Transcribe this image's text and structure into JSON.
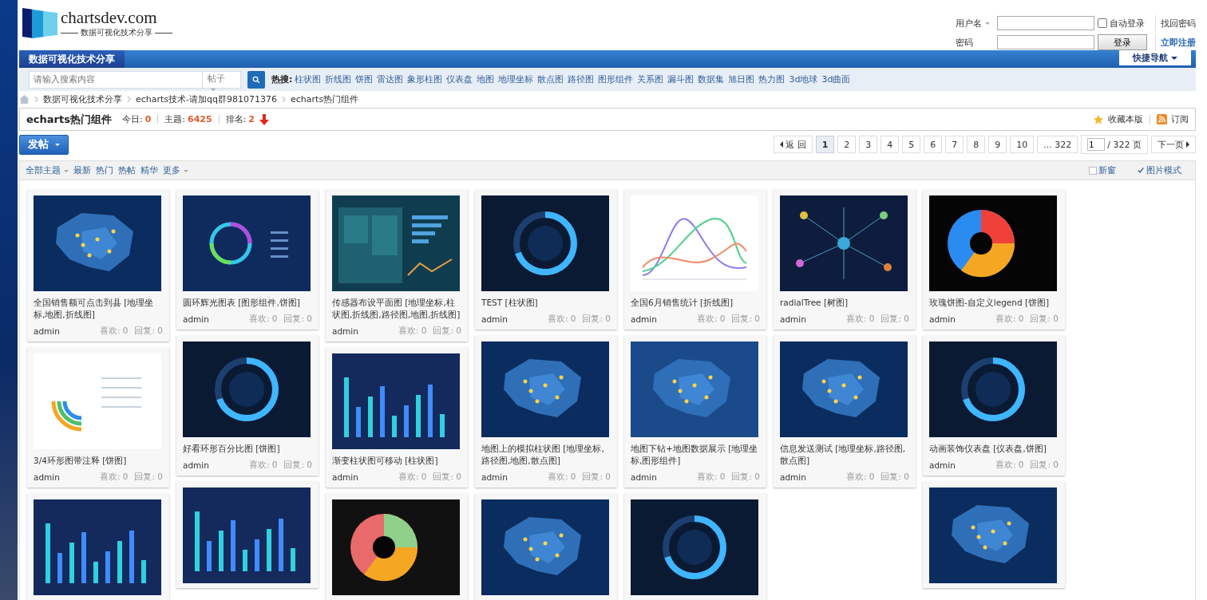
{
  "logo": {
    "name": "chartsdev.com",
    "tagline": "数据可视化技术分享"
  },
  "login": {
    "username_label": "用户名",
    "password_label": "密码",
    "remember": {
      "label": "自动登录",
      "checked": false
    },
    "forgot": "找回密码",
    "submit": "登录",
    "register": "立即注册"
  },
  "nav": {
    "home_tab": "数据可视化技术分享",
    "quick_nav": "快捷导航"
  },
  "search": {
    "placeholder": "请输入搜索内容",
    "scope": "帖子",
    "hot_label": "热搜:",
    "hot": [
      "柱状图",
      "折线图",
      "饼图",
      "雷达图",
      "象形柱图",
      "仪表盘",
      "地图",
      "地理坐标",
      "散点图",
      "路径图",
      "图形组件",
      "关系图",
      "漏斗图",
      "数据集",
      "旭日图",
      "热力图",
      "3d地球",
      "3d曲面"
    ]
  },
  "breadcrumb": [
    "数据可视化技术分享",
    "echarts技术-请加qq群981071376",
    "echarts热门组件"
  ],
  "forum": {
    "title": "echarts热门组件",
    "stats": [
      {
        "label": "今日:",
        "value": "0"
      },
      {
        "label": "主题:",
        "value": "6425"
      },
      {
        "label": "排名:",
        "value": "2"
      }
    ],
    "favorite": "收藏本版",
    "subscribe": "订阅"
  },
  "post_button": "发帖",
  "pagination": {
    "back": "返 回",
    "pages": [
      {
        "label": "1",
        "selected": true
      },
      {
        "label": "2",
        "selected": false
      },
      {
        "label": "3",
        "selected": false
      },
      {
        "label": "4",
        "selected": false
      },
      {
        "label": "5",
        "selected": false
      },
      {
        "label": "6",
        "selected": false
      },
      {
        "label": "7",
        "selected": false
      },
      {
        "label": "8",
        "selected": false
      },
      {
        "label": "9",
        "selected": false
      },
      {
        "label": "10",
        "selected": false
      }
    ],
    "last": "... 322",
    "page_input": "1",
    "total": "/ 322 页",
    "next": "下一页"
  },
  "filters": {
    "all": "全部主题",
    "links": [
      "最新",
      "热门",
      "热帖",
      "精华"
    ],
    "more": "更多",
    "options": [
      {
        "label": "新窗",
        "checked": false
      },
      {
        "label": "图片模式",
        "checked": true
      }
    ]
  },
  "columns": [
    [
      {
        "title": "全国销售额可点击到县 [地理坐标,地图,折线图]",
        "author": "admin",
        "likes": "喜欢: 0",
        "replies": "回复: 0"
      },
      {
        "title": "3/4环形图带注释 [饼图]",
        "author": "admin",
        "likes": "喜欢: 0",
        "replies": "回复: 0"
      },
      {
        "kind": "picture"
      }
    ],
    [
      {
        "title": "圆环辉光图表 [图形组件,饼图]",
        "author": "admin",
        "likes": "喜欢: 0",
        "replies": "回复: 0"
      },
      {
        "title": "好看环形百分比图 [饼图]",
        "author": "admin",
        "likes": "喜欢: 0",
        "replies": "回复: 0"
      },
      {
        "kind": "picture"
      }
    ],
    [
      {
        "title": "传感器布设平面图 [地理坐标,柱状图,折线图,路径图,地图,折线图]",
        "author": "admin",
        "likes": "喜欢: 0",
        "replies": "回复: 0"
      },
      {
        "title": "渐变柱状图可移动 [柱状图]",
        "author": "admin",
        "likes": "喜欢: 0",
        "replies": "回复: 0"
      },
      {
        "kind": "picture"
      }
    ],
    [
      {
        "title": "TEST [柱状图]",
        "author": "admin",
        "likes": "喜欢: 0",
        "replies": "回复: 0"
      },
      {
        "title": "地图上的模拟柱状图 [地理坐标,路径图,地图,散点图]",
        "author": "admin",
        "likes": "喜欢: 0",
        "replies": "回复: 0"
      },
      {
        "kind": "picture"
      }
    ],
    [
      {
        "title": "全国6月销售统计 [折线图]",
        "author": "admin",
        "likes": "喜欢: 0",
        "replies": "回复: 0"
      },
      {
        "title": "地图下钻+地图数据展示 [地理坐标,图形组件]",
        "author": "admin",
        "likes": "喜欢: 0",
        "replies": "回复: 0"
      },
      {
        "kind": "picture"
      }
    ],
    [
      {
        "title": "radialTree [树图]",
        "author": "admin",
        "likes": "喜欢: 0",
        "replies": "回复: 0"
      },
      {
        "title": "信息发送测试 [地理坐标,路径图,散点图]",
        "author": "admin",
        "likes": "喜欢: 0",
        "replies": "回复: 0"
      }
    ],
    [
      {
        "title": "玫瑰饼图-自定义legend [饼图]",
        "author": "admin",
        "likes": "喜欢: 0",
        "replies": "回复: 0"
      },
      {
        "title": "动画装饰仪表盘 [仪表盘,饼图]",
        "author": "admin",
        "likes": "喜欢: 0",
        "replies": "回复: 0"
      },
      {
        "kind": "picture"
      }
    ]
  ]
}
